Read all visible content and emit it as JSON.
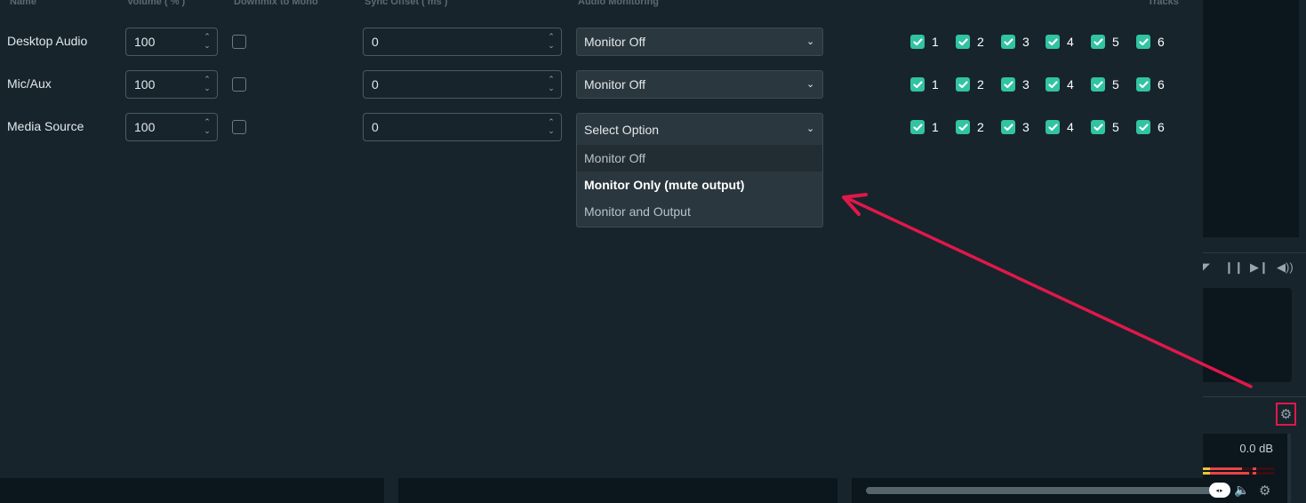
{
  "headers": {
    "name": "Name",
    "volume": "Volume ( % )",
    "downmix": "Downmix to Mono",
    "sync_offset": "Sync Offset ( ms )",
    "monitoring": "Audio Monitoring",
    "tracks": "Tracks"
  },
  "rows": [
    {
      "name": "Desktop Audio",
      "volume": "100",
      "downmix": false,
      "sync_offset": "0",
      "monitoring": "Monitor Off",
      "tracks": [
        {
          "n": "1",
          "checked": true
        },
        {
          "n": "2",
          "checked": true
        },
        {
          "n": "3",
          "checked": true
        },
        {
          "n": "4",
          "checked": true
        },
        {
          "n": "5",
          "checked": true
        },
        {
          "n": "6",
          "checked": true
        }
      ]
    },
    {
      "name": "Mic/Aux",
      "volume": "100",
      "downmix": false,
      "sync_offset": "0",
      "monitoring": "Monitor Off",
      "tracks": [
        {
          "n": "1",
          "checked": true
        },
        {
          "n": "2",
          "checked": true
        },
        {
          "n": "3",
          "checked": true
        },
        {
          "n": "4",
          "checked": true
        },
        {
          "n": "5",
          "checked": true
        },
        {
          "n": "6",
          "checked": true
        }
      ]
    },
    {
      "name": "Media Source",
      "volume": "100",
      "downmix": false,
      "sync_offset": "0",
      "monitoring": "Select Option",
      "tracks": [
        {
          "n": "1",
          "checked": true
        },
        {
          "n": "2",
          "checked": true
        },
        {
          "n": "3",
          "checked": true
        },
        {
          "n": "4",
          "checked": true
        },
        {
          "n": "5",
          "checked": true
        },
        {
          "n": "6",
          "checked": true
        }
      ]
    }
  ],
  "dropdown": {
    "options": [
      "Monitor Off",
      "Monitor Only (mute output)",
      "Monitor and Output"
    ],
    "hovered": "Monitor Off",
    "highlighted": "Monitor Only (mute output)"
  },
  "mixer": {
    "level": "0.0 dB",
    "meter_fill": [
      0.45,
      0.55
    ]
  },
  "icons": {
    "chevron": "⌄",
    "spin_up": "⌃",
    "spin_down": "⌄",
    "gear": "⚙",
    "pause": "❙❙",
    "next": "⏭",
    "volume": "🔊",
    "mute": "🔈",
    "knob": "◂▸"
  },
  "colors": {
    "accent": "#31c3a2",
    "annotation": "#e0184a",
    "panel": "#17242c",
    "select_bg": "#2b373e"
  }
}
